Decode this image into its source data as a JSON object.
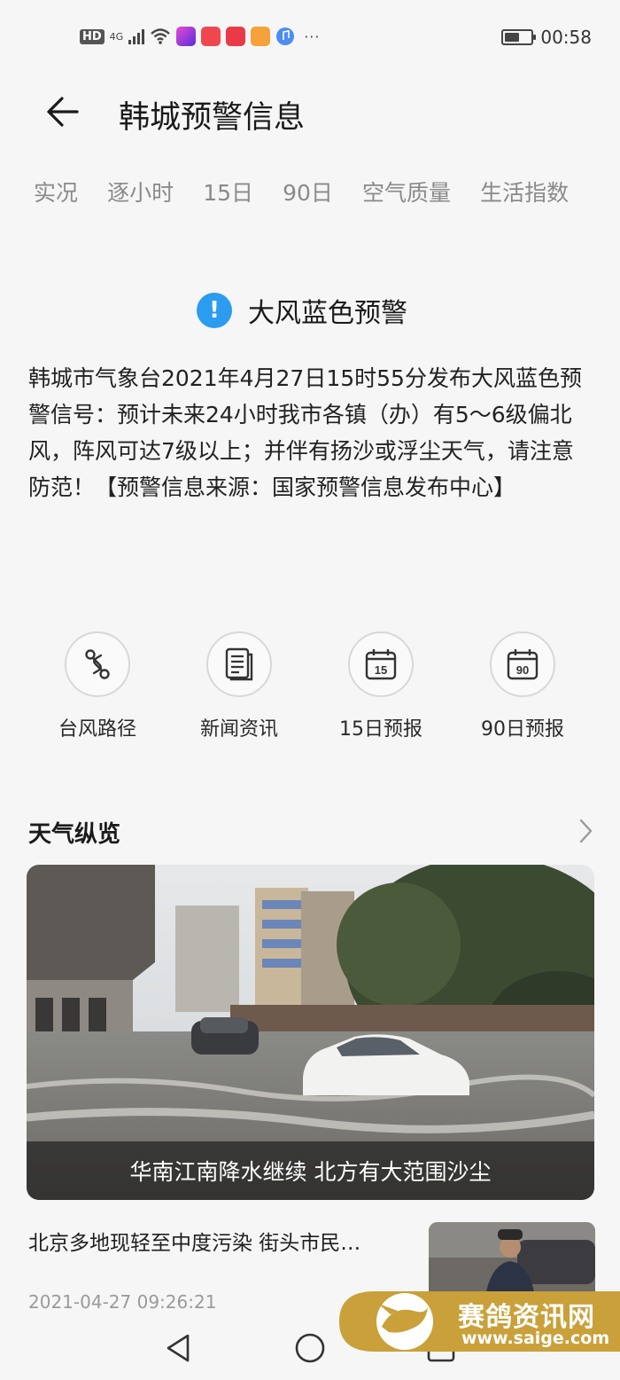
{
  "status_bar": {
    "hd": "HD",
    "network": "4G",
    "time": "00:58",
    "more": "···",
    "battery_level": 0.55
  },
  "header": {
    "title": "韩城预警信息"
  },
  "tabs": [
    {
      "label": "实况"
    },
    {
      "label": "逐小时"
    },
    {
      "label": "15日"
    },
    {
      "label": "90日"
    },
    {
      "label": "空气质量"
    },
    {
      "label": "生活指数"
    }
  ],
  "alert": {
    "title": "大风蓝色预警",
    "icon": "!",
    "icon_color": "#2b9cf0",
    "body": "韩城市气象台2021年4月27日15时55分发布大风蓝色预警信号：预计未来24小时我市各镇（办）有5～6级偏北风，阵风可达7级以上；并伴有扬沙或浮尘天气，请注意防范！【预警信息来源：国家预警信息发布中心】"
  },
  "actions": [
    {
      "label": "台风路径",
      "icon": "route-icon"
    },
    {
      "label": "新闻资讯",
      "icon": "news-icon"
    },
    {
      "label": "15日预报",
      "icon": "calendar-15-icon",
      "icon_text": "15"
    },
    {
      "label": "90日预报",
      "icon": "calendar-90-icon",
      "icon_text": "90"
    }
  ],
  "overview": {
    "title": "天气纵览",
    "featured": {
      "caption": "华南江南降水继续 北方有大范围沙尘"
    },
    "items": [
      {
        "title": "北京多地现轻至中度污染 街头市民…",
        "date": "2021-04-27 09:26:21"
      }
    ]
  },
  "watermark": {
    "name": "赛鸽资讯网",
    "url": "www.saige.com",
    "color": "#c9a03a"
  }
}
